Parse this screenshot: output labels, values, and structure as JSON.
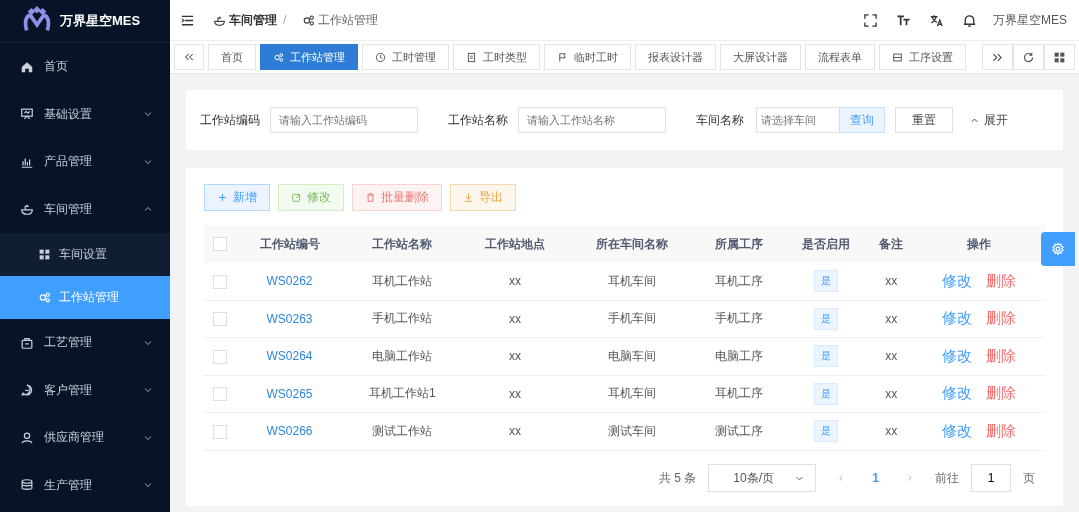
{
  "app": {
    "title": "万界星空MES"
  },
  "sidebar": {
    "items": [
      {
        "label": "首页",
        "selected": false
      },
      {
        "label": "基础设置",
        "expanded": false,
        "selected": false
      },
      {
        "label": "产品管理",
        "expanded": false,
        "selected": false
      },
      {
        "label": "车间管理",
        "expanded": true,
        "selected": false,
        "children": [
          {
            "label": "车间设置",
            "selected": false
          },
          {
            "label": "工作站管理",
            "selected": true
          }
        ]
      },
      {
        "label": "工艺管理",
        "expanded": false,
        "selected": false
      },
      {
        "label": "客户管理",
        "expanded": false,
        "selected": false
      },
      {
        "label": "供应商管理",
        "expanded": false,
        "selected": false
      },
      {
        "label": "生产管理",
        "expanded": false,
        "selected": false
      }
    ]
  },
  "header": {
    "breadcrumb": [
      "车间管理",
      "工作站管理"
    ],
    "separator": "/",
    "user": "万界星空MES"
  },
  "tags": [
    {
      "label": "首页",
      "selected": false
    },
    {
      "label": "工作站管理",
      "selected": true
    },
    {
      "label": "工时管理",
      "selected": false
    },
    {
      "label": "工时类型",
      "selected": false
    },
    {
      "label": "临时工时",
      "selected": false
    },
    {
      "label": "报表设计器",
      "selected": false
    },
    {
      "label": "大屏设计器",
      "selected": false
    },
    {
      "label": "流程表单",
      "selected": false
    },
    {
      "label": "工序设置",
      "selected": false
    }
  ],
  "search": {
    "fields": [
      {
        "label": "工作站编码",
        "placeholder": "请输入工作站编码"
      },
      {
        "label": "工作站名称",
        "placeholder": "请输入工作站名称"
      },
      {
        "label": "车间名称",
        "placeholder": "请选择车间"
      }
    ],
    "buttons": [
      "查询",
      "重置"
    ],
    "expand": "展开"
  },
  "toolbar": [
    {
      "label": "新增",
      "kind": "primary",
      "disabled": false
    },
    {
      "label": "修改",
      "kind": "success",
      "disabled": true
    },
    {
      "label": "批量删除",
      "kind": "danger",
      "disabled": true
    },
    {
      "label": "导出",
      "kind": "warning",
      "disabled": false
    }
  ],
  "table": {
    "select_all_checked": false,
    "columns": [
      "工作站编号",
      "工作站名称",
      "工作站地点",
      "所在车间名称",
      "所属工序",
      "是否启用",
      "备注",
      "操作"
    ],
    "rows": [
      {
        "checked": false,
        "code": "WS0262",
        "name": "耳机工作站",
        "location": "xx",
        "workshop": "耳机车间",
        "process": "耳机工序",
        "enabled": "是",
        "remark": "xx",
        "actions": [
          "修改",
          "删除"
        ]
      },
      {
        "checked": false,
        "code": "WS0263",
        "name": "手机工作站",
        "location": "xx",
        "workshop": "手机车间",
        "process": "手机工序",
        "enabled": "是",
        "remark": "xx",
        "actions": [
          "修改",
          "删除"
        ]
      },
      {
        "checked": false,
        "code": "WS0264",
        "name": "电脑工作站",
        "location": "xx",
        "workshop": "电脑车间",
        "process": "电脑工序",
        "enabled": "是",
        "remark": "xx",
        "actions": [
          "修改",
          "删除"
        ]
      },
      {
        "checked": false,
        "code": "WS0265",
        "name": "耳机工作站1",
        "location": "xx",
        "workshop": "耳机车间",
        "process": "耳机工序",
        "enabled": "是",
        "remark": "xx",
        "actions": [
          "修改",
          "删除"
        ]
      },
      {
        "checked": false,
        "code": "WS0266",
        "name": "测试工作站",
        "location": "xx",
        "workshop": "测试车间",
        "process": "测试工序",
        "enabled": "是",
        "remark": "xx",
        "actions": [
          "修改",
          "删除"
        ]
      }
    ]
  },
  "pagination": {
    "total": "共 5 条",
    "page_size": "10条/页",
    "pages": [
      {
        "label": "1",
        "selected": true
      }
    ],
    "goto_label": "前往",
    "goto_value": "1",
    "goto_suffix": "页"
  }
}
